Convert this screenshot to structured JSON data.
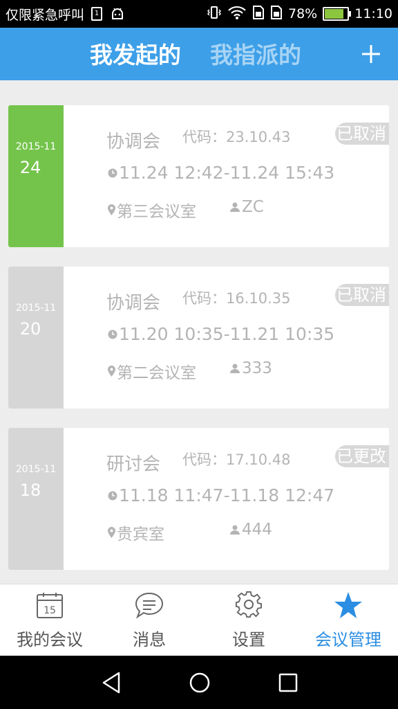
{
  "status_bar": {
    "carrier": "仅限紧急呼叫",
    "sim_label": "1",
    "battery": "78%",
    "battery_level": 0.78,
    "time": "11:10",
    "icons": [
      "sim-icon",
      "android-debug-icon",
      "vibrate-icon",
      "wifi-icon",
      "sim-card-icon",
      "sim-card-icon",
      "battery-icon"
    ]
  },
  "header": {
    "tab_active": "我发起的",
    "tab_inactive": "我指派的",
    "add_icon": "plus-icon",
    "color": "#3d9fe8"
  },
  "meetings": [
    {
      "year_month": "2015-11",
      "day": "24",
      "title": "协调会",
      "code": "代码：23.10.43",
      "status": "已取消",
      "time": "11.24 12:42-11.24 15:43",
      "place": "第三会议室",
      "person": "ZC",
      "date_color": "#74c44b"
    },
    {
      "year_month": "2015-11",
      "day": "20",
      "title": "协调会",
      "code": "代码：16.10.35",
      "status": "已取消",
      "time": "11.20 10:35-11.21 10:35",
      "place": "第二会议室",
      "person": "333",
      "date_color": "#d6d6d6"
    },
    {
      "year_month": "2015-11",
      "day": "18",
      "title": "研讨会",
      "code": "代码：17.10.48",
      "status": "已更改",
      "time": "11.18 11:47-11.18 12:47",
      "place": "贵宾室",
      "person": "444",
      "date_color": "#d6d6d6"
    }
  ],
  "bottom_nav": {
    "items": [
      {
        "label": "我的会议",
        "icon": "calendar-icon",
        "calendar_day": "15"
      },
      {
        "label": "消息",
        "icon": "message-icon"
      },
      {
        "label": "设置",
        "icon": "gear-icon"
      },
      {
        "label": "会议管理",
        "icon": "star-icon"
      }
    ],
    "active_index": 3,
    "active_color": "#2b8ee2"
  },
  "system_nav": [
    "back-icon",
    "home-icon",
    "recents-icon"
  ]
}
